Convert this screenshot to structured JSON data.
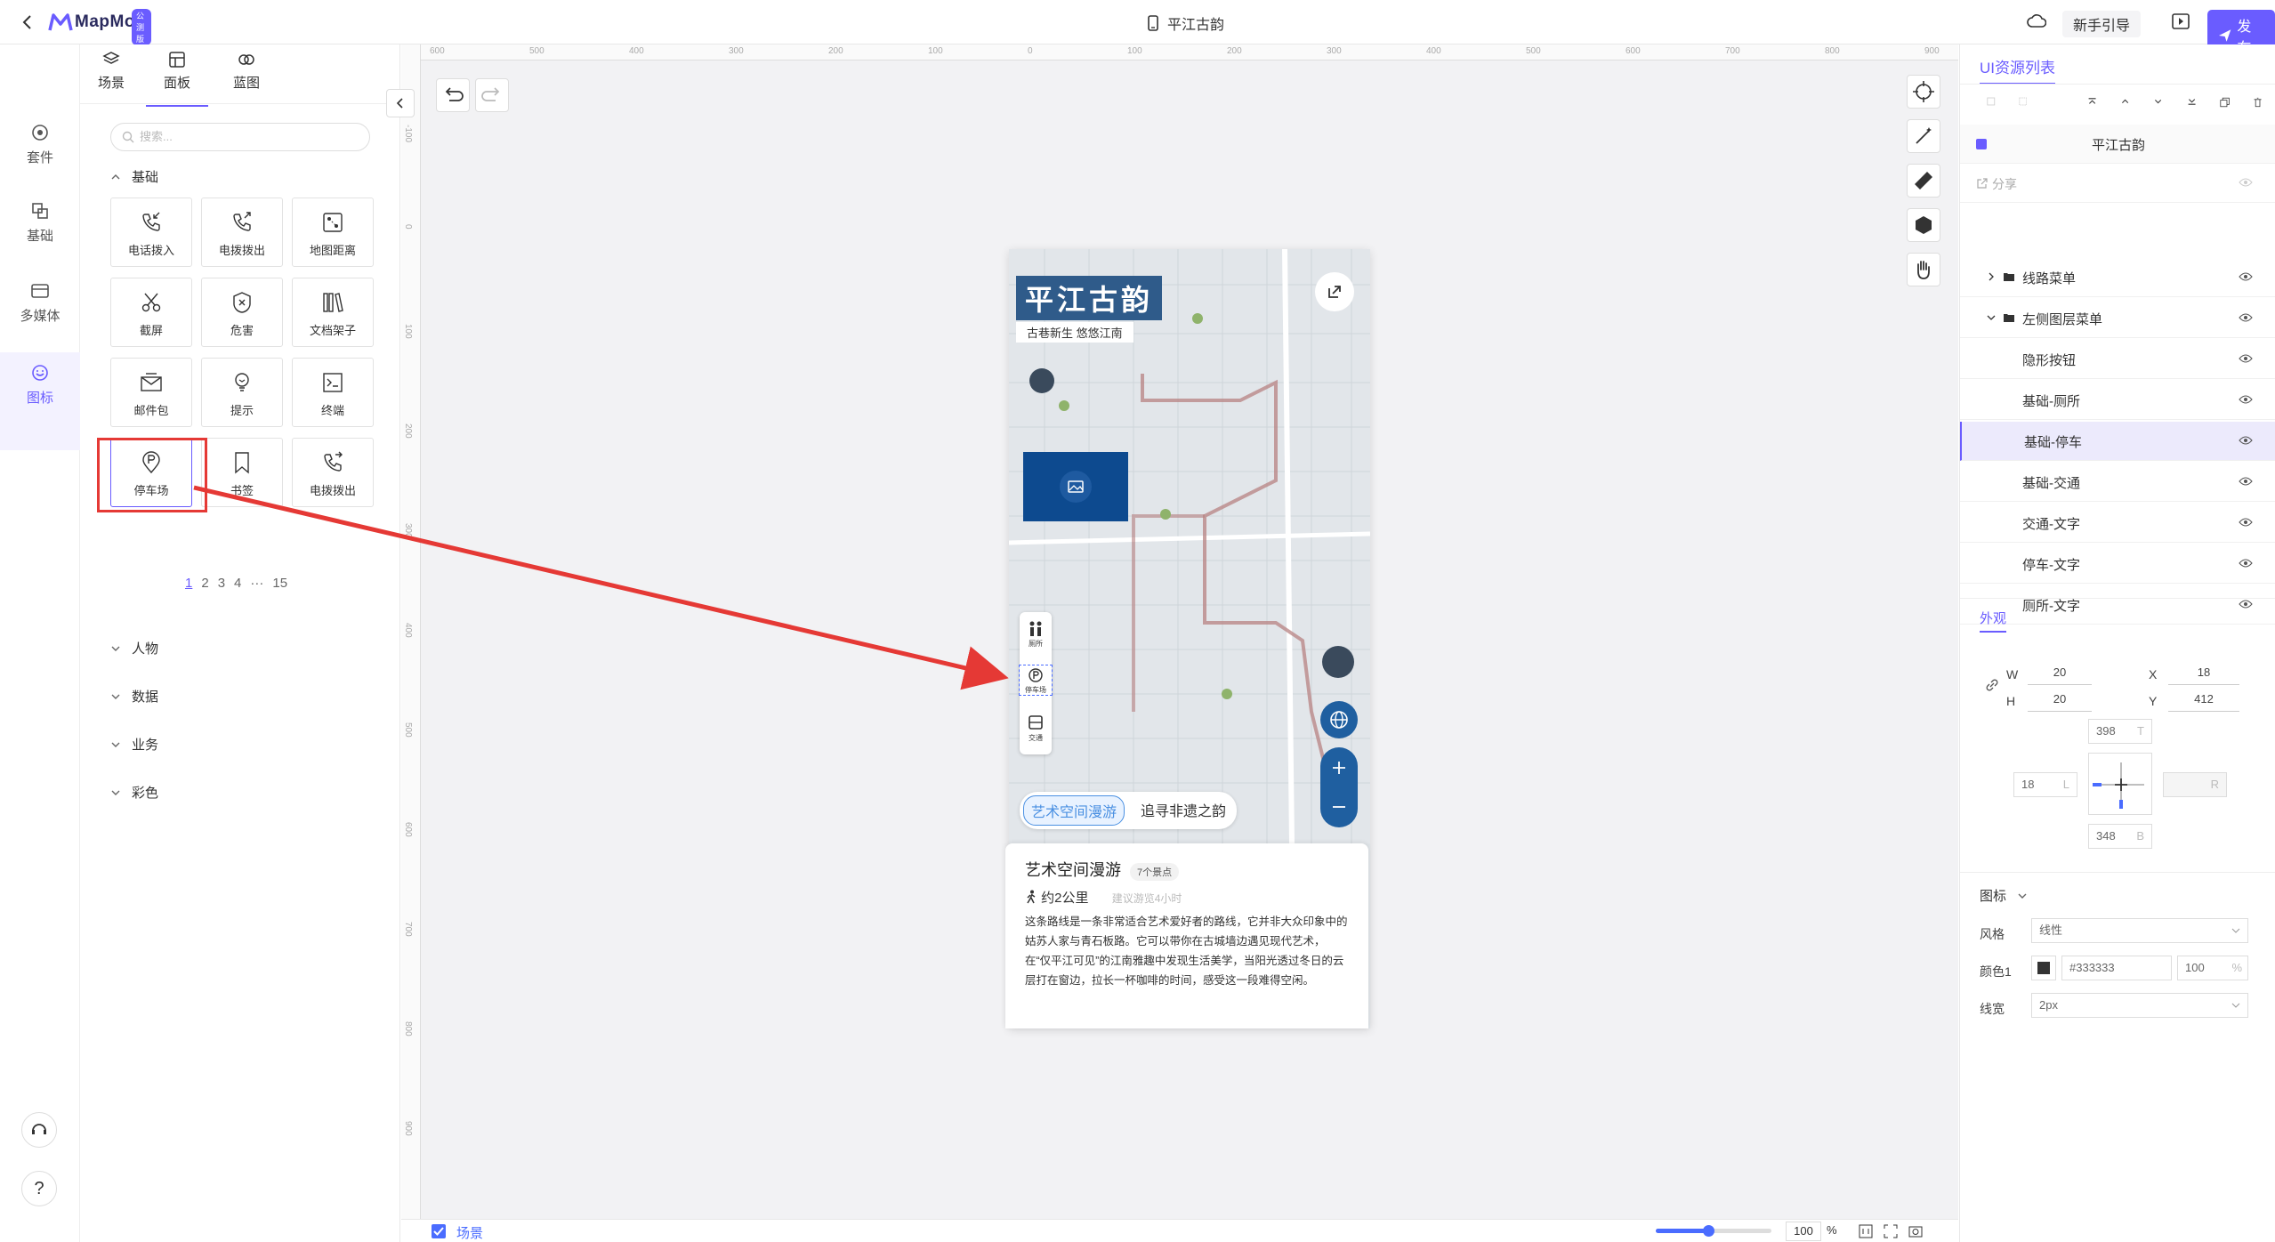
{
  "topbar": {
    "logo_text": "MapMost",
    "logo_badge": "公测版",
    "doc_title": "平江古韵",
    "guide_label": "新手引导",
    "publish_label": "发布"
  },
  "rail": {
    "items": [
      {
        "label": "套件",
        "icon": "kit-icon"
      },
      {
        "label": "基础",
        "icon": "basic-icon"
      },
      {
        "label": "多媒体",
        "icon": "media-icon"
      },
      {
        "label": "图标",
        "icon": "smiley-icon"
      }
    ]
  },
  "panel": {
    "tabs": [
      {
        "label": "场景"
      },
      {
        "label": "面板"
      },
      {
        "label": "蓝图"
      }
    ],
    "search_placeholder": "搜索...",
    "section_basic": "基础",
    "tiles": [
      {
        "label": "电话拨入",
        "icon": "phone-incoming-icon"
      },
      {
        "label": "电拨拨出",
        "icon": "phone-outgoing-icon"
      },
      {
        "label": "地图距离",
        "icon": "map-distance-icon"
      },
      {
        "label": "截屏",
        "icon": "scissors-icon"
      },
      {
        "label": "危害",
        "icon": "shield-x-icon"
      },
      {
        "label": "文档架子",
        "icon": "bookshelf-icon"
      },
      {
        "label": "邮件包",
        "icon": "mailbox-icon"
      },
      {
        "label": "提示",
        "icon": "lightbulb-icon"
      },
      {
        "label": "终端",
        "icon": "terminal-icon"
      },
      {
        "label": "停车场",
        "icon": "parking-icon"
      },
      {
        "label": "书签",
        "icon": "bookmark-icon"
      },
      {
        "label": "电拨拨出",
        "icon": "phone-outgoing-icon"
      }
    ],
    "pager": [
      "1",
      "2",
      "3",
      "4",
      "···",
      "15"
    ],
    "sections": [
      "人物",
      "数据",
      "业务",
      "彩色"
    ]
  },
  "map": {
    "title": "平江古韵",
    "subtitle": "古巷新生  悠悠江南",
    "left_tools": [
      "厕所",
      "停车场",
      "交通"
    ],
    "chips": [
      "艺术空间漫游",
      "追寻非遗之韵"
    ],
    "card": {
      "title": "艺术空间漫游",
      "badge": "7个景点",
      "distance": "约2公里",
      "suggest": "建议游览4小时",
      "desc": "这条路线是一条非常适合艺术爱好者的路线，它并非大众印象中的姑苏人家与青石板路。它可以带你在古城墙边遇见现代艺术，在“仅平江可见”的江南雅趣中发现生活美学，当阳光透过冬日的云层打在窗边，拉长一杯咖啡的时间，感受这一段难得空闲。"
    }
  },
  "canvas": {
    "h_ruler": [
      "600",
      "500",
      "400",
      "300",
      "200",
      "100",
      "0",
      "100",
      "200",
      "300",
      "400",
      "500",
      "600",
      "700",
      "800",
      "900"
    ],
    "v_ruler": [
      "-100",
      "0",
      "100",
      "200",
      "300",
      "400",
      "500",
      "600",
      "700",
      "800",
      "900"
    ]
  },
  "bottom": {
    "scene_label": "场景",
    "zoom": "100",
    "zoom_unit": "%",
    "zoom_level": 0.45
  },
  "right": {
    "title": "UI资源列表",
    "root_label": "平江古韵",
    "share_label": "分享",
    "layers": [
      {
        "label": "线路菜单",
        "indent": 1,
        "folder": true
      },
      {
        "label": "左侧图层菜单",
        "indent": 1,
        "folder": true
      },
      {
        "label": "隐形按钮",
        "indent": 2
      },
      {
        "label": "基础-厕所",
        "indent": 2
      },
      {
        "label": "基础-停车",
        "indent": 2
      },
      {
        "label": "基础-交通",
        "indent": 2
      },
      {
        "label": "交通-文字",
        "indent": 2
      },
      {
        "label": "停车-文字",
        "indent": 2
      },
      {
        "label": "厕所-文字",
        "indent": 2
      }
    ],
    "appearance_tab": "外观",
    "w_label": "W",
    "w_value": "20",
    "h_label": "H",
    "h_value": "20",
    "x_label": "X",
    "x_value": "18",
    "y_label": "Y",
    "y_value": "412",
    "top_value": "398",
    "top_label": "T",
    "left_value": "18",
    "left_label": "L",
    "right_label": "R",
    "bottom_value": "348",
    "bottom_label": "B",
    "icon_section": "图标",
    "style_label": "风格",
    "style_value": "线性",
    "color_label": "颜色1",
    "color_value": "#333333",
    "color_opacity": "100",
    "opacity_unit": "%",
    "linewidth_label": "线宽",
    "linewidth_value": "2px"
  },
  "colors": {
    "accent": "#6a5cff",
    "arrow": "#e53935",
    "map_title_bg": "#2f5b8a",
    "image_block": "#0d4a8f"
  }
}
